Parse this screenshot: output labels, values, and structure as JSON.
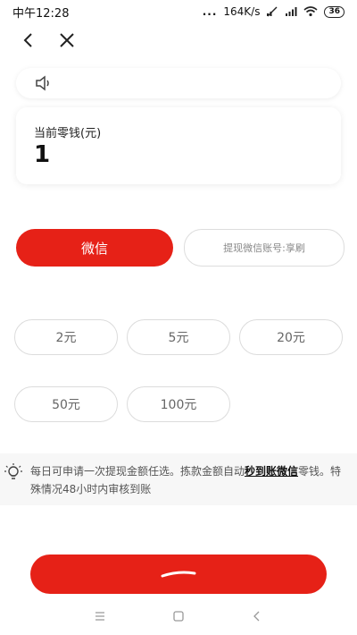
{
  "status_bar": {
    "time": "中午12:28",
    "dots": "...",
    "speed": "164K/s",
    "battery": "36"
  },
  "header": {
    "back_icon": "chevron-left-icon",
    "close_icon": "close-icon"
  },
  "notice": {
    "icon": "speaker-icon"
  },
  "balance": {
    "label": "当前零钱(元)",
    "value": "1"
  },
  "withdraw_method": {
    "wechat_label": "微信",
    "account_text": "提现微信账号:享刷"
  },
  "amounts": [
    "2元",
    "5元",
    "20元",
    "50元",
    "100元"
  ],
  "tip": {
    "icon": "bulb-icon",
    "text_before": "每日可申请一次提现金额任选。拣款金额自动",
    "link_text": "秒到账微信",
    "text_after": "零钱。特殊情况48小时内审核到账"
  },
  "colors": {
    "accent": "#e62117",
    "card_border": "#dcdcdc"
  }
}
